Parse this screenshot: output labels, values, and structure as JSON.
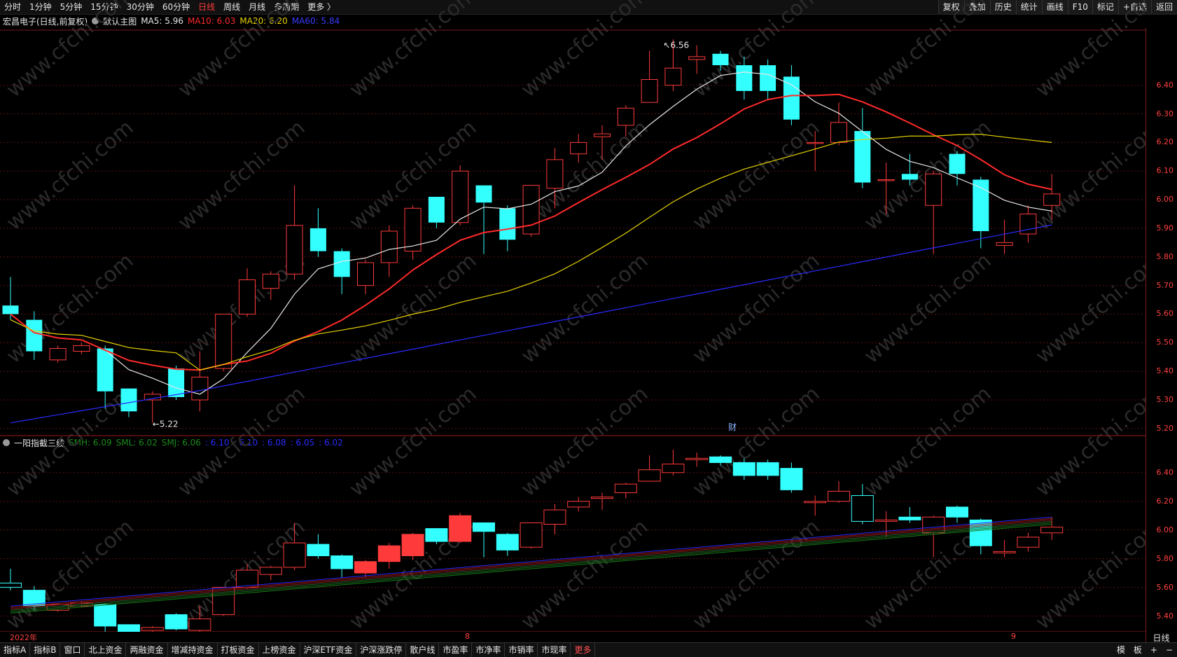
{
  "topbar": {
    "periods": [
      "分时",
      "1分钟",
      "5分钟",
      "15分钟",
      "30分钟",
      "60分钟",
      "日线",
      "周线",
      "月线",
      "多周期",
      "更多 〉"
    ],
    "active_period": "日线",
    "right_buttons": [
      "复权",
      "叠加",
      "历史",
      "统计",
      "画线",
      "F10",
      "标记",
      "+自选",
      "返回"
    ]
  },
  "main_header": {
    "stock": "宏昌电子(日线,前复权)",
    "indicator": "默认主图",
    "ma5": "MA5: 5.96",
    "ma10": "MA10: 6.03",
    "ma20": "MA20: 6.20",
    "ma60": "MA60: 5.84",
    "colors": {
      "ma5": "#e6e6e6",
      "ma10": "#ff2a2a",
      "ma20": "#e6d200",
      "ma60": "#2a2aff"
    }
  },
  "sub_header": {
    "indicator": "一阳指截三线",
    "smh": "SMH: 6.09",
    "sml": "SML: 6.02",
    "smj": "SMJ: 6.06",
    "v1": ": 6.10",
    "v2": ": 6.10",
    "v3": ": 6.08",
    "v4": ": 6.05",
    "v5": ": 6.02"
  },
  "axis_main": [
    "6.40",
    "6.30",
    "6.20",
    "6.10",
    "6.00",
    "5.90",
    "5.80",
    "5.70",
    "5.60",
    "5.50",
    "5.40",
    "5.30",
    "5.20"
  ],
  "axis_sub": [
    "6.40",
    "6.20",
    "6.00",
    "5.80",
    "5.60",
    "5.40"
  ],
  "annotations": {
    "high": "6.56",
    "low": "5.22",
    "marker": "财"
  },
  "timeline": {
    "year": "2022年",
    "m8": "8",
    "m9": "9"
  },
  "period_label": "日线",
  "watermark": "www.cfchi.com",
  "bottombar": {
    "buttons": [
      "指标A",
      "指标B",
      "窗口",
      "北上资金",
      "两融资金",
      "增减持资金",
      "打板资金",
      "上榜资金",
      "沪深ETF资金",
      "沪深涨跌停",
      "散户线",
      "市盈率",
      "市净率",
      "市销率",
      "市现率",
      "更多"
    ],
    "right": [
      "模",
      "板",
      "+",
      "−"
    ]
  },
  "chart_data": {
    "type": "candlestick",
    "price_range": [
      5.18,
      6.6
    ],
    "candles": [
      {
        "o": 5.63,
        "c": 5.6,
        "h": 5.73,
        "l": 5.58
      },
      {
        "o": 5.58,
        "c": 5.47,
        "h": 5.61,
        "l": 5.44
      },
      {
        "o": 5.44,
        "c": 5.48,
        "h": 5.49,
        "l": 5.43
      },
      {
        "o": 5.47,
        "c": 5.49,
        "h": 5.5,
        "l": 5.46
      },
      {
        "o": 5.48,
        "c": 5.33,
        "h": 5.49,
        "l": 5.27
      },
      {
        "o": 5.34,
        "c": 5.26,
        "h": 5.34,
        "l": 5.24
      },
      {
        "o": 5.3,
        "c": 5.32,
        "h": 5.33,
        "l": 5.22
      },
      {
        "o": 5.41,
        "c": 5.31,
        "h": 5.42,
        "l": 5.3
      },
      {
        "o": 5.3,
        "c": 5.38,
        "h": 5.47,
        "l": 5.26
      },
      {
        "o": 5.41,
        "c": 5.6,
        "h": 5.6,
        "l": 5.4
      },
      {
        "o": 5.6,
        "c": 5.72,
        "h": 5.76,
        "l": 5.59
      },
      {
        "o": 5.69,
        "c": 5.74,
        "h": 5.75,
        "l": 5.65
      },
      {
        "o": 5.74,
        "c": 5.91,
        "h": 6.05,
        "l": 5.72
      },
      {
        "o": 5.9,
        "c": 5.82,
        "h": 5.97,
        "l": 5.8
      },
      {
        "o": 5.82,
        "c": 5.73,
        "h": 5.83,
        "l": 5.67
      },
      {
        "o": 5.7,
        "c": 5.78,
        "h": 5.79,
        "l": 5.67
      },
      {
        "o": 5.78,
        "c": 5.89,
        "h": 5.91,
        "l": 5.73
      },
      {
        "o": 5.82,
        "c": 5.97,
        "h": 5.98,
        "l": 5.79
      },
      {
        "o": 6.01,
        "c": 5.92,
        "h": 6.01,
        "l": 5.9
      },
      {
        "o": 5.92,
        "c": 6.1,
        "h": 6.12,
        "l": 5.91
      },
      {
        "o": 6.05,
        "c": 5.99,
        "h": 6.05,
        "l": 5.81
      },
      {
        "o": 5.97,
        "c": 5.86,
        "h": 5.98,
        "l": 5.82
      },
      {
        "o": 5.88,
        "c": 6.05,
        "h": 6.05,
        "l": 5.87
      },
      {
        "o": 6.04,
        "c": 6.14,
        "h": 6.18,
        "l": 5.97
      },
      {
        "o": 6.16,
        "c": 6.2,
        "h": 6.23,
        "l": 6.13
      },
      {
        "o": 6.22,
        "c": 6.23,
        "h": 6.26,
        "l": 6.14
      },
      {
        "o": 6.26,
        "c": 6.32,
        "h": 6.33,
        "l": 6.22
      },
      {
        "o": 6.34,
        "c": 6.42,
        "h": 6.52,
        "l": 6.34
      },
      {
        "o": 6.4,
        "c": 6.46,
        "h": 6.56,
        "l": 6.38
      },
      {
        "o": 6.49,
        "c": 6.5,
        "h": 6.54,
        "l": 6.44
      },
      {
        "o": 6.51,
        "c": 6.47,
        "h": 6.52,
        "l": 6.45
      },
      {
        "o": 6.47,
        "c": 6.38,
        "h": 6.5,
        "l": 6.35
      },
      {
        "o": 6.47,
        "c": 6.38,
        "h": 6.49,
        "l": 6.35
      },
      {
        "o": 6.43,
        "c": 6.28,
        "h": 6.47,
        "l": 6.26
      },
      {
        "o": 6.2,
        "c": 6.2,
        "h": 6.24,
        "l": 6.1
      },
      {
        "o": 6.2,
        "c": 6.27,
        "h": 6.34,
        "l": 6.19
      },
      {
        "o": 6.24,
        "c": 6.06,
        "h": 6.32,
        "l": 6.04
      },
      {
        "o": 6.07,
        "c": 6.07,
        "h": 6.13,
        "l": 5.95
      },
      {
        "o": 6.09,
        "c": 6.07,
        "h": 6.16,
        "l": 6.05
      },
      {
        "o": 5.98,
        "c": 6.09,
        "h": 6.1,
        "l": 5.81
      },
      {
        "o": 6.16,
        "c": 6.09,
        "h": 6.17,
        "l": 6.05
      },
      {
        "o": 6.07,
        "c": 5.89,
        "h": 6.08,
        "l": 5.83
      },
      {
        "o": 5.84,
        "c": 5.85,
        "h": 5.93,
        "l": 5.81
      },
      {
        "o": 5.88,
        "c": 5.95,
        "h": 5.98,
        "l": 5.85
      },
      {
        "o": 5.98,
        "c": 6.02,
        "h": 6.09,
        "l": 5.93
      }
    ]
  }
}
